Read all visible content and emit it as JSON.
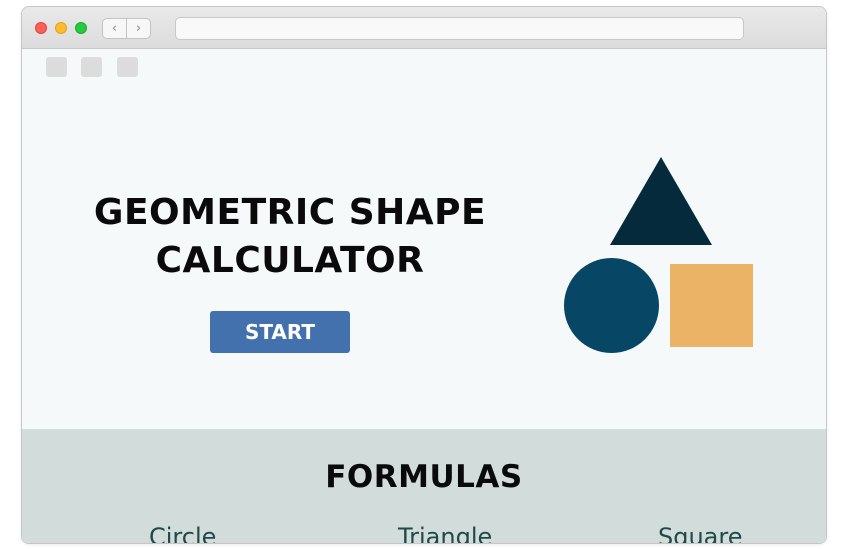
{
  "browser": {
    "nav_back_icon": "chevron-left-icon",
    "nav_forward_icon": "chevron-right-icon",
    "back_glyph": "‹",
    "forward_glyph": "›",
    "address": ""
  },
  "hero": {
    "title": "GEOMETRIC SHAPE CALCULATOR",
    "start_label": "START",
    "shape_colors": {
      "triangle": "#042a3c",
      "circle": "#084665",
      "square": "#ebb365"
    }
  },
  "formulas": {
    "title": "FORMULAS",
    "shapes": [
      "Circle",
      "Triangle",
      "Square"
    ]
  },
  "colors": {
    "button": "#4371ae",
    "formulas_bg": "#d2dddb",
    "page_bg": "#f6f9fa"
  }
}
